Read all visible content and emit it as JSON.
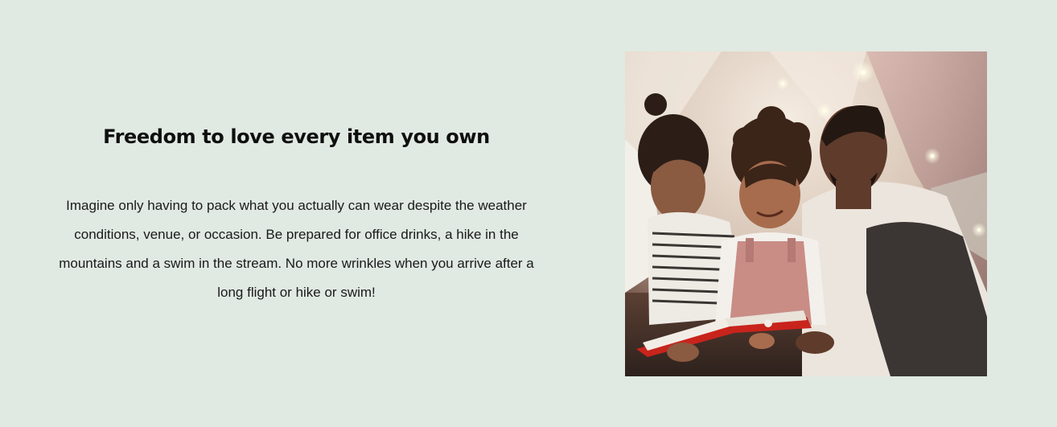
{
  "feature": {
    "heading": "Freedom to love every item you own",
    "body": "Imagine only having to pack what you actually can wear despite the weather conditions, venue, or occasion. Be prepared for office drinks, a hike in the mountains and a swim in the stream. No more wrinkles when you arrive after a long flight or hike or swim!",
    "image_subject": "family reading a book together in a blanket tent"
  },
  "colors": {
    "background": "#e0e9e2",
    "heading": "#0f0f0f",
    "body": "#1a1a1a"
  }
}
